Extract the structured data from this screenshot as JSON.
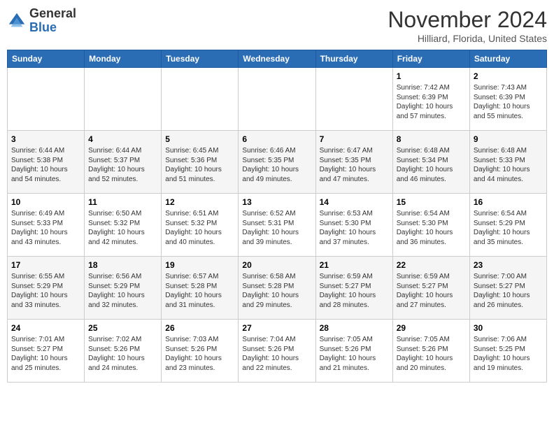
{
  "logo": {
    "general": "General",
    "blue": "Blue"
  },
  "header": {
    "month": "November 2024",
    "location": "Hilliard, Florida, United States"
  },
  "weekdays": [
    "Sunday",
    "Monday",
    "Tuesday",
    "Wednesday",
    "Thursday",
    "Friday",
    "Saturday"
  ],
  "weeks": [
    [
      {
        "day": "",
        "info": ""
      },
      {
        "day": "",
        "info": ""
      },
      {
        "day": "",
        "info": ""
      },
      {
        "day": "",
        "info": ""
      },
      {
        "day": "",
        "info": ""
      },
      {
        "day": "1",
        "info": "Sunrise: 7:42 AM\nSunset: 6:39 PM\nDaylight: 10 hours and 57 minutes."
      },
      {
        "day": "2",
        "info": "Sunrise: 7:43 AM\nSunset: 6:39 PM\nDaylight: 10 hours and 55 minutes."
      }
    ],
    [
      {
        "day": "3",
        "info": "Sunrise: 6:44 AM\nSunset: 5:38 PM\nDaylight: 10 hours and 54 minutes."
      },
      {
        "day": "4",
        "info": "Sunrise: 6:44 AM\nSunset: 5:37 PM\nDaylight: 10 hours and 52 minutes."
      },
      {
        "day": "5",
        "info": "Sunrise: 6:45 AM\nSunset: 5:36 PM\nDaylight: 10 hours and 51 minutes."
      },
      {
        "day": "6",
        "info": "Sunrise: 6:46 AM\nSunset: 5:35 PM\nDaylight: 10 hours and 49 minutes."
      },
      {
        "day": "7",
        "info": "Sunrise: 6:47 AM\nSunset: 5:35 PM\nDaylight: 10 hours and 47 minutes."
      },
      {
        "day": "8",
        "info": "Sunrise: 6:48 AM\nSunset: 5:34 PM\nDaylight: 10 hours and 46 minutes."
      },
      {
        "day": "9",
        "info": "Sunrise: 6:48 AM\nSunset: 5:33 PM\nDaylight: 10 hours and 44 minutes."
      }
    ],
    [
      {
        "day": "10",
        "info": "Sunrise: 6:49 AM\nSunset: 5:33 PM\nDaylight: 10 hours and 43 minutes."
      },
      {
        "day": "11",
        "info": "Sunrise: 6:50 AM\nSunset: 5:32 PM\nDaylight: 10 hours and 42 minutes."
      },
      {
        "day": "12",
        "info": "Sunrise: 6:51 AM\nSunset: 5:32 PM\nDaylight: 10 hours and 40 minutes."
      },
      {
        "day": "13",
        "info": "Sunrise: 6:52 AM\nSunset: 5:31 PM\nDaylight: 10 hours and 39 minutes."
      },
      {
        "day": "14",
        "info": "Sunrise: 6:53 AM\nSunset: 5:30 PM\nDaylight: 10 hours and 37 minutes."
      },
      {
        "day": "15",
        "info": "Sunrise: 6:54 AM\nSunset: 5:30 PM\nDaylight: 10 hours and 36 minutes."
      },
      {
        "day": "16",
        "info": "Sunrise: 6:54 AM\nSunset: 5:29 PM\nDaylight: 10 hours and 35 minutes."
      }
    ],
    [
      {
        "day": "17",
        "info": "Sunrise: 6:55 AM\nSunset: 5:29 PM\nDaylight: 10 hours and 33 minutes."
      },
      {
        "day": "18",
        "info": "Sunrise: 6:56 AM\nSunset: 5:29 PM\nDaylight: 10 hours and 32 minutes."
      },
      {
        "day": "19",
        "info": "Sunrise: 6:57 AM\nSunset: 5:28 PM\nDaylight: 10 hours and 31 minutes."
      },
      {
        "day": "20",
        "info": "Sunrise: 6:58 AM\nSunset: 5:28 PM\nDaylight: 10 hours and 29 minutes."
      },
      {
        "day": "21",
        "info": "Sunrise: 6:59 AM\nSunset: 5:27 PM\nDaylight: 10 hours and 28 minutes."
      },
      {
        "day": "22",
        "info": "Sunrise: 6:59 AM\nSunset: 5:27 PM\nDaylight: 10 hours and 27 minutes."
      },
      {
        "day": "23",
        "info": "Sunrise: 7:00 AM\nSunset: 5:27 PM\nDaylight: 10 hours and 26 minutes."
      }
    ],
    [
      {
        "day": "24",
        "info": "Sunrise: 7:01 AM\nSunset: 5:27 PM\nDaylight: 10 hours and 25 minutes."
      },
      {
        "day": "25",
        "info": "Sunrise: 7:02 AM\nSunset: 5:26 PM\nDaylight: 10 hours and 24 minutes."
      },
      {
        "day": "26",
        "info": "Sunrise: 7:03 AM\nSunset: 5:26 PM\nDaylight: 10 hours and 23 minutes."
      },
      {
        "day": "27",
        "info": "Sunrise: 7:04 AM\nSunset: 5:26 PM\nDaylight: 10 hours and 22 minutes."
      },
      {
        "day": "28",
        "info": "Sunrise: 7:05 AM\nSunset: 5:26 PM\nDaylight: 10 hours and 21 minutes."
      },
      {
        "day": "29",
        "info": "Sunrise: 7:05 AM\nSunset: 5:26 PM\nDaylight: 10 hours and 20 minutes."
      },
      {
        "day": "30",
        "info": "Sunrise: 7:06 AM\nSunset: 5:25 PM\nDaylight: 10 hours and 19 minutes."
      }
    ]
  ]
}
